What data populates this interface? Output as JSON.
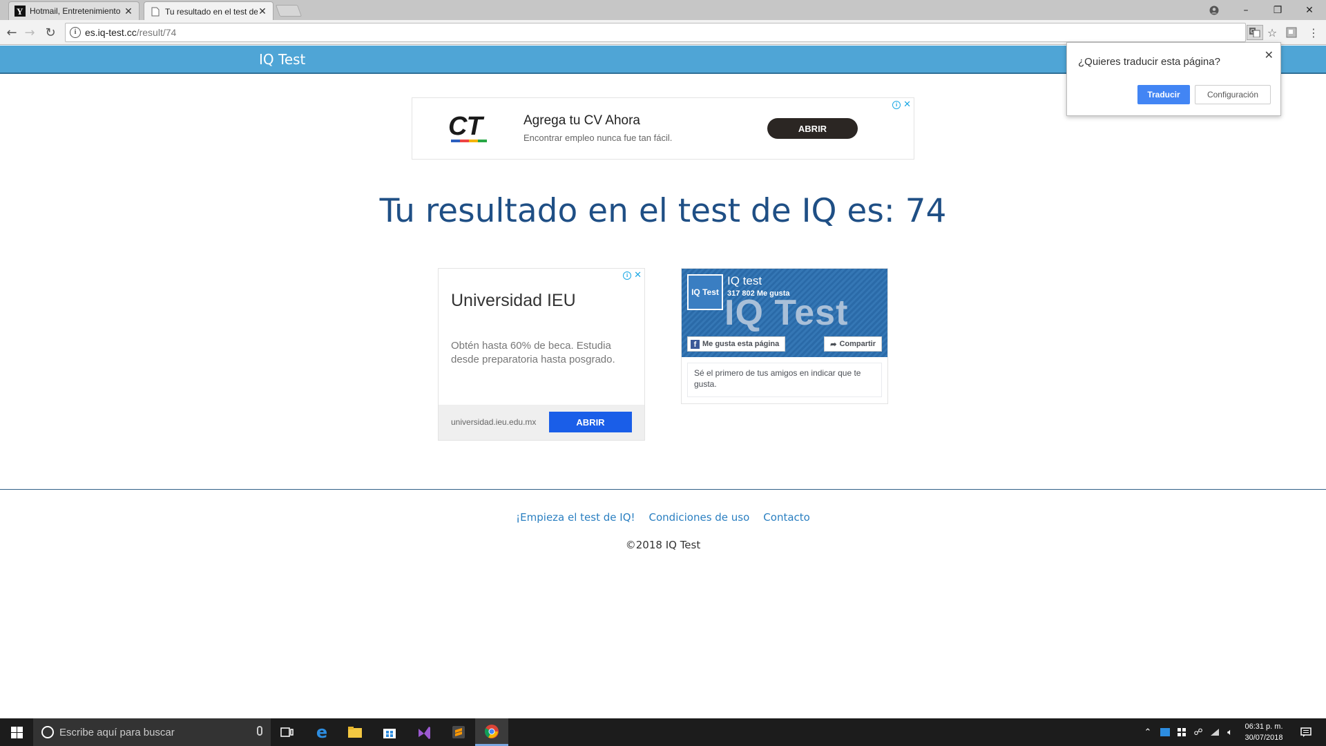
{
  "browser": {
    "tabs": [
      {
        "title": "Hotmail, Entretenimiento"
      },
      {
        "title": "Tu resultado en el test de"
      }
    ],
    "url_host": "es.iq-test.cc",
    "url_path": "/result/74"
  },
  "site": {
    "brand": "IQ Test",
    "headline": "Tu resultado en el test de IQ es: 74",
    "iq_score": 74
  },
  "ads": {
    "top": {
      "logo": "CT",
      "title": "Agrega tu CV Ahora",
      "subtitle": "Encontrar empleo nunca fue tan fácil.",
      "button": "ABRIR"
    },
    "left": {
      "title": "Universidad IEU",
      "description": "Obtén hasta 60% de beca. Estudia desde preparatoria hasta posgrado.",
      "url": "universidad.ieu.edu.mx",
      "button": "ABRIR"
    }
  },
  "facebook": {
    "page_pic": "IQ Test",
    "name": "IQ test",
    "likes": "317 802 Me gusta",
    "cover_text": "IQ Test",
    "like_button": "Me gusta esta página",
    "share_button": "Compartir",
    "friends_text": "Sé el primero de tus amigos en indicar que te gusta."
  },
  "footer": {
    "links": [
      "¡Empieza el test de IQ!",
      "Condiciones de uso",
      "Contacto"
    ],
    "copyright": "©2018 IQ Test"
  },
  "translate_bubble": {
    "question": "¿Quieres traducir esta página?",
    "translate_button": "Traducir",
    "settings_button": "Configuración"
  },
  "taskbar": {
    "search_placeholder": "Escribe aquí para buscar",
    "time": "06:31 p. m.",
    "date": "30/07/2018"
  },
  "colors": {
    "site_bar": "#4fa5d6",
    "headline": "#1f4f85",
    "link": "#2a7fc1",
    "translate_primary": "#4285f4"
  }
}
